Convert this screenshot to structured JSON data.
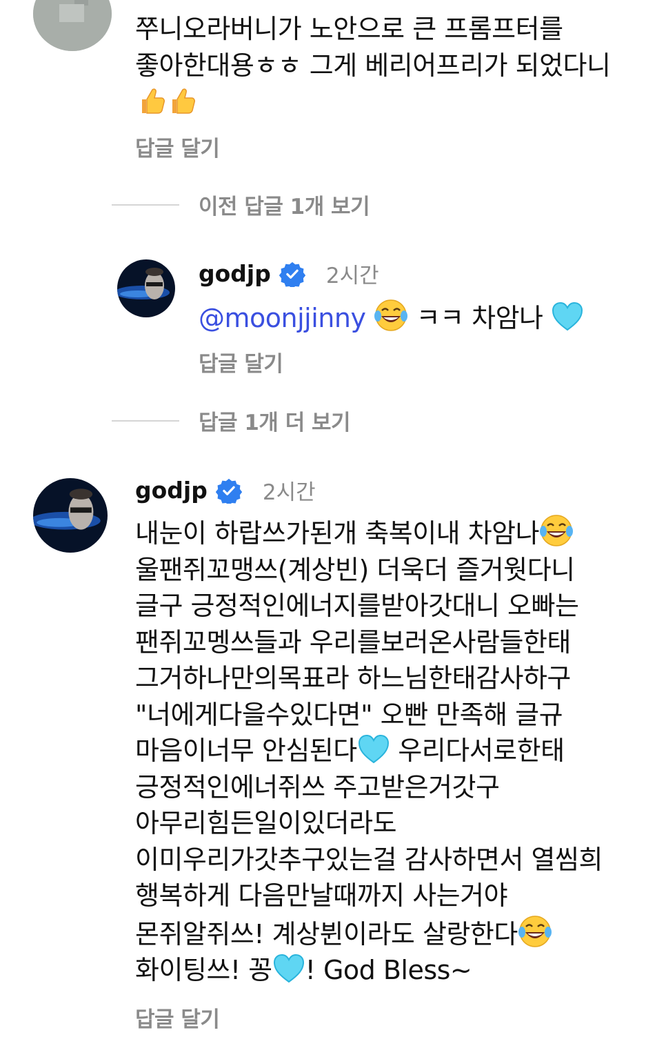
{
  "comment_top": {
    "lines": [
      "쭈니오라버니가 노안으로 큰 프롬프터를",
      "좋아한대용ㅎㅎ 그게 베리어프리가 되었다니"
    ],
    "emoji_line": "👍👍",
    "reply_label": "답글 달기"
  },
  "toggle_previous": {
    "label": "이전 답글 1개 보기"
  },
  "reply_godjp": {
    "username": "godjp",
    "time": "2시간",
    "mention": "@moonjjinny",
    "text_after": "ㅋㅋ 차암나",
    "reply_label": "답글 달기"
  },
  "toggle_more": {
    "label": "답글 1개 더 보기"
  },
  "comment_godjp": {
    "username": "godjp",
    "time": "2시간",
    "lines": [
      "내눈이 하랍쓰가된개 축복이내 차암나",
      "울팬쥐꼬맹쓰(계상빈) 더욱더 즐거웟다니",
      "글구 긍정적인에너지를받아갓대니 오빠는",
      "팬쥐꼬멩쓰들과 우리를보러온사람들한태",
      "그거하나만의목표라 하느님한태감사하구",
      "\"너에게다을수있다면\" 오빤 만족해 글규",
      "마음이너무 안심된다",
      "긍정적인에너쥐쓰 주고받은거갓구",
      "아무리힘든일이있더라도",
      "이미우리가갓추구있는걸 감사하면서 열씸희",
      "행복하게 다음만날때까지 사는거야",
      "몬쥐알쥐쓰! 계상뷘이라도 살랑한다",
      "화이팅쓰! 꽁"
    ],
    "line7_after": " 우리다서로한태",
    "line13_after": "! God Bless~",
    "reply_label": "답글 달기"
  },
  "colors": {
    "accent_blue": "#3a4fe0",
    "verified_blue": "#2f7ff0",
    "muted_text": "#8a8a8a"
  },
  "icons": [
    "thumbs-up-icon",
    "laughing-emoji-icon",
    "blue-heart-icon",
    "verified-badge-icon"
  ]
}
